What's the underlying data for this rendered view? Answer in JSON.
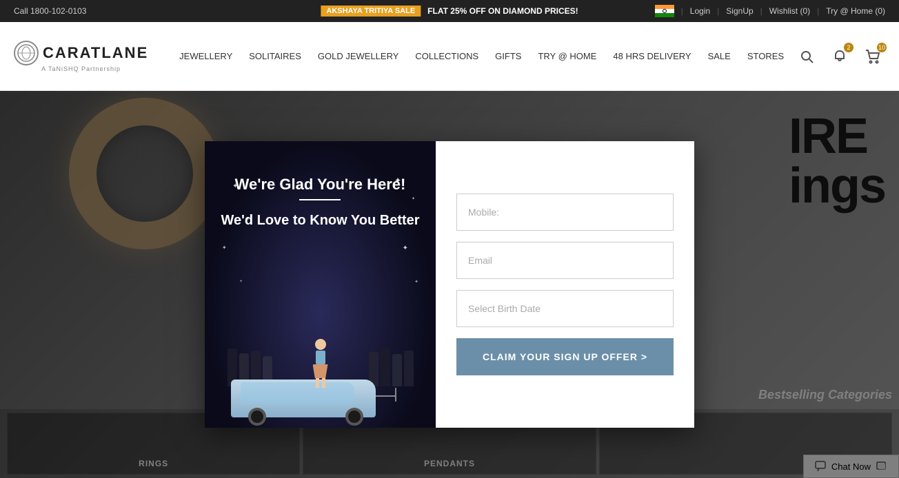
{
  "topbar": {
    "phone": "Call 1800-102-0103",
    "sale_badge": "AKSHAYA TRITIYA SALE",
    "sale_text": "FLAT 25% OFF ON DIAMOND PRICES!",
    "login": "Login",
    "signup": "SignUp",
    "wishlist": "Wishlist (0)",
    "try_home": "Try @ Home (0)"
  },
  "header": {
    "logo_brand": "CARATLANE",
    "logo_sub": "A TaNiSHQ Partnership",
    "nav": [
      {
        "label": "JEWELLERY"
      },
      {
        "label": "SOLITAIRES"
      },
      {
        "label": "GOLD JEWELLERY"
      },
      {
        "label": "COLLECTIONS"
      },
      {
        "label": "GIFTS"
      },
      {
        "label": "TRY @ HOME"
      },
      {
        "label": "48 HRS DELIVERY"
      },
      {
        "label": "SALE"
      },
      {
        "label": "STORES"
      }
    ],
    "notification_count": "2",
    "cart_count": "10"
  },
  "modal": {
    "left": {
      "title": "We're Glad You're Here!",
      "subtitle": "We'd Love to Know You Better"
    },
    "right": {
      "mobile_placeholder": "Mobile:",
      "email_placeholder": "Email",
      "birthdate_placeholder": "Select Birth Date",
      "cta_button": "CLAIM YOUR SIGN UP OFFER >"
    }
  },
  "bottom_thumbs": [
    {
      "label": "RINGS"
    },
    {
      "label": "PENDANTS"
    },
    {
      "label": "Bestselling Categories"
    }
  ],
  "chat": {
    "label": "Chat Now"
  },
  "hero_text": {
    "line1": "IRE",
    "line2": "ings"
  },
  "sparkles": [
    "✦",
    "✦",
    "✦",
    "✦",
    "✦",
    "✦",
    "✦",
    "✦"
  ]
}
